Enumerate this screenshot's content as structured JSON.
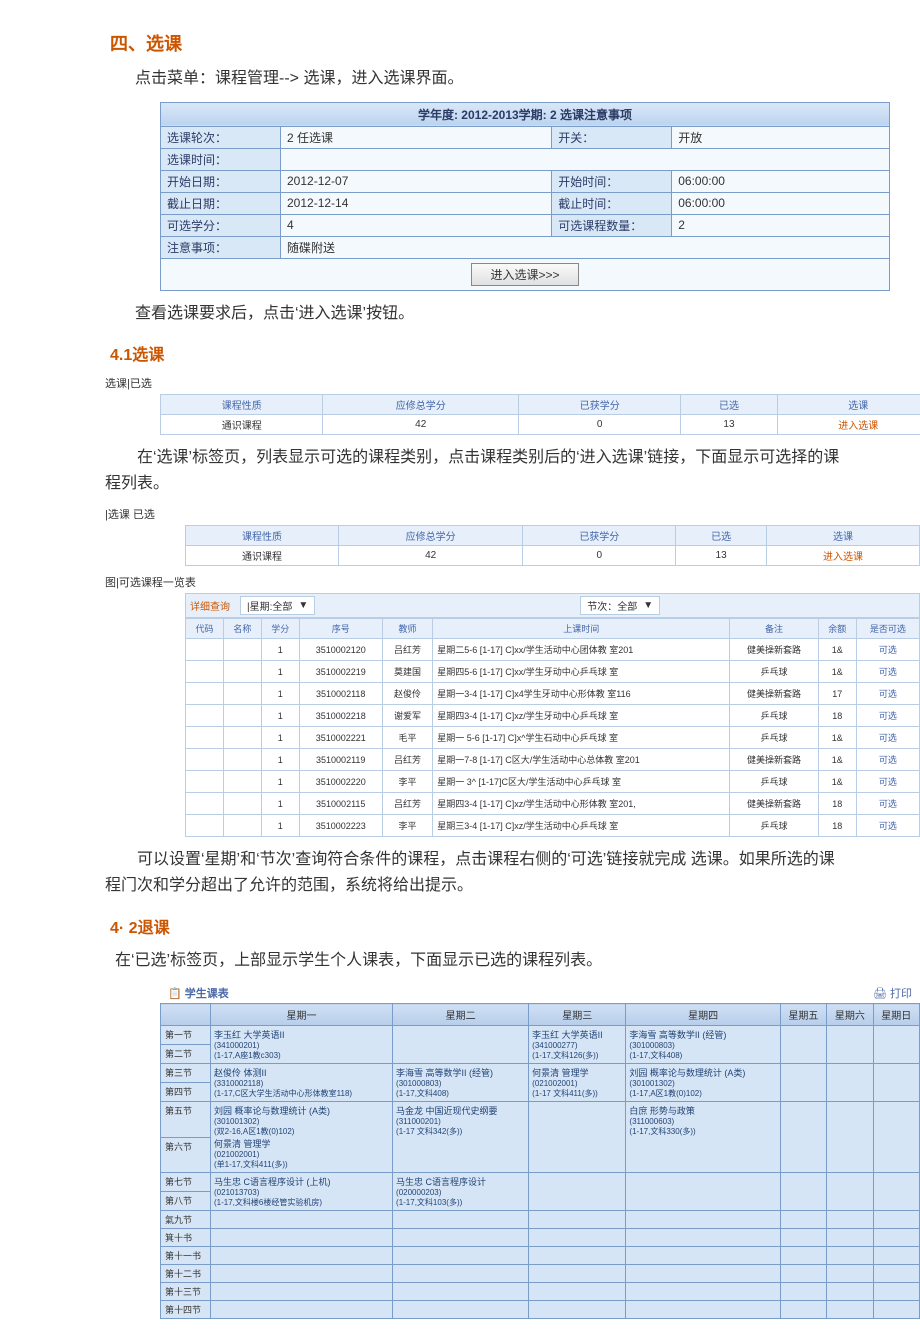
{
  "headings": {
    "h_select": "四、选课",
    "p1": "点击菜单：课程管理--> 选课，进入选课界面。",
    "h_41": "4.1选课",
    "tab_label_1": "选课|已选",
    "p2": "在‘选课’标签页，列表显示可选的课程类别，点击课程类别后的‘进入选课’链接，下面显示可选择的课程列表。",
    "tab_label_2": "|选课 已选",
    "list_label": "图|可选课程一览表",
    "p3": "可以设置‘星期’和‘节次’查询符合条件的课程，点击课程右侧的‘可选’链接就完成 选课。如果所选的课程门次和学分超出了允许的范围，系统将给出提示。",
    "h_42": "4· 2退课",
    "p4": "在‘已选’标签页，上部显示学生个人课表，下面显示已选的课程列表。"
  },
  "info": {
    "header": "学年度: 2012-2013学期: 2 选课注意事项",
    "rows": [
      {
        "l1": "选课轮次：",
        "v1": "2 任选课",
        "l2": "开关：",
        "v2": "开放"
      },
      {
        "l1": "选课时间：",
        "v1": "",
        "l2": "",
        "v2": ""
      },
      {
        "l1": "开始日期：",
        "v1": "2012-12-07",
        "l2": "开始时间：",
        "v2": "06:00:00"
      },
      {
        "l1": "截止日期：",
        "v1": "2012-12-14",
        "l2": "截止时间：",
        "v2": "06:00:00"
      },
      {
        "l1": "可选学分：",
        "v1": "4",
        "l2": "可选课程数量：",
        "v2": "2"
      },
      {
        "l1": "注意事项：",
        "v1": "随碟附送",
        "l2": "",
        "v2": ""
      }
    ],
    "enter_btn": "进入选课>>>"
  },
  "cat_headers": [
    "课程性质",
    "应修总学分",
    "已获学分",
    "已选",
    "选课"
  ],
  "cat_row": {
    "c1": "通识课程",
    "c2": "42",
    "c3": "0",
    "c4": "13",
    "c5": "进入选课"
  },
  "filter": {
    "detail": "详细查询",
    "week_label": "|星期:全部",
    "section_label": "节次：全部"
  },
  "course_headers": [
    "代码",
    "名称",
    "学分",
    "序号",
    "教师",
    "上课时间",
    "备注",
    "余额",
    "是否可选"
  ],
  "courses": [
    {
      "credit": "1",
      "seq": "3510002120",
      "teacher": "吕红芳",
      "time": "星期二5-6 [1-17] C]xx/学生活动中心团体教 室201",
      "remark": "健美操新套路",
      "remain": "1&",
      "sel": "可选"
    },
    {
      "credit": "1",
      "seq": "3510002219",
      "teacher": "莫建国",
      "time": "星期四5-6 [1-17] C]xx/学生牙动中心乒乓球 室",
      "remark": "乒乓球",
      "remain": "1&",
      "sel": "可选"
    },
    {
      "credit": "1",
      "seq": "3510002118",
      "teacher": "赵俊伶",
      "time": "星期一3-4 [1-17] C]x4学生牙动中心形体教 室116",
      "remark": "健美操新套路",
      "remain": "17",
      "sel": "可选"
    },
    {
      "credit": "1",
      "seq": "3510002218",
      "teacher": "谢爱军",
      "time": "星期四3-4 [1-17] C]xz/学生牙动中心乒乓球 室",
      "remark": "乒乓球",
      "remain": "18",
      "sel": "可选"
    },
    {
      "credit": "1",
      "seq": "3510002221",
      "teacher": "毛平",
      "time": "星期一 5-6 [1-17] C]x^学生石动中心乒乓球  室",
      "remark": "乒乓球",
      "remain": "1&",
      "sel": "可选"
    },
    {
      "credit": "1",
      "seq": "3510002119",
      "teacher": "吕红芳",
      "time": "星期一7-8 [1-17] C区大/学生活动中心总体教 室201",
      "remark": "健美操新套路",
      "remain": "1&",
      "sel": "可选"
    },
    {
      "credit": "1",
      "seq": "3510002220",
      "teacher": "李平",
      "time": "星期一 3^ [1-17]C区大/学生活动中心乒乓球 室",
      "remark": "乒乓球",
      "remain": "1&",
      "sel": "可选"
    },
    {
      "credit": "1",
      "seq": "3510002115",
      "teacher": "吕红芳",
      "time": "星期四3-4 [1-17] C]xz/学生活动中心形体教 室201,",
      "remark": "健美操新套路",
      "remain": "18",
      "sel": "可选"
    },
    {
      "credit": "1",
      "seq": "3510002223",
      "teacher": "李平",
      "time": "星期三3-4 [1-17] C]xz/学生活动中心乒乓球  室",
      "remark": "乒乓球",
      "remain": "18",
      "sel": "可选"
    }
  ],
  "tt": {
    "title": "学生课表",
    "print": "打印",
    "days": [
      "",
      "星期一",
      "星期二",
      "星期三",
      "星期四",
      "星期五",
      "星期六",
      "星期日"
    ],
    "periods": [
      "第一节",
      "第二节",
      "第三节",
      "第四节",
      "第五节",
      "第六节",
      "第七节",
      "第八节",
      "氣九节",
      "箕十书",
      "第十一书",
      "第十二书",
      "第十三节",
      "第十四节"
    ],
    "cells": {
      "mon12": {
        "t": "李玉红 大学英语II",
        "s": "(341000201)\n(1-17,A座1教c303)"
      },
      "wed12": {
        "t": "李玉红 大学英语II",
        "s": "(341000277)\n(1-17,文科126(多))"
      },
      "thu12": {
        "t": "李海雪 高等数学II (经管)",
        "s": "(301000803)\n(1-17,文科408)"
      },
      "mon34": {
        "t": "赵俊伶 体测II",
        "s": "(3310002118)\n(1-17,C区大学生活动中心形体教室118)"
      },
      "tue34": {
        "t": "李海雪 高等数学II (经管)",
        "s": "(301000803)\n(1-17,文科408)"
      },
      "wed34": {
        "t": "何景清 管理学",
        "s": "(021002001)\n(1-17 文科411(多))"
      },
      "thu34": {
        "t": "刘园 概率论与数理统计 (A类)",
        "s": "(301001302)\n(1-17,A区1教(0)102)"
      },
      "mon56a": {
        "t": "刘园 概率论与数理统计 (A类)",
        "s": "(301001302)\n(双2-16,A区1教(0)102)"
      },
      "mon56b": {
        "t": "何景清 管理学",
        "s": "(021002001)\n(单1-17,文科411(多))"
      },
      "tue56": {
        "t": "马金龙 中国近现代史纲要",
        "s": "(311000201)\n(1-17 文科342(多))"
      },
      "thu56": {
        "t": "白庶 形势与政策",
        "s": "(311000603)\n(1-17,文科330(多))"
      },
      "mon78": {
        "t": "马生忠 C语言程序设计 (上机)",
        "s": "(021013703)\n(1-17,文科楼6楼经管实验机房)"
      },
      "tue78": {
        "t": "马生忠 C语言程序设计",
        "s": "(020000203)\n(1-17,文科103(多))"
      }
    }
  }
}
